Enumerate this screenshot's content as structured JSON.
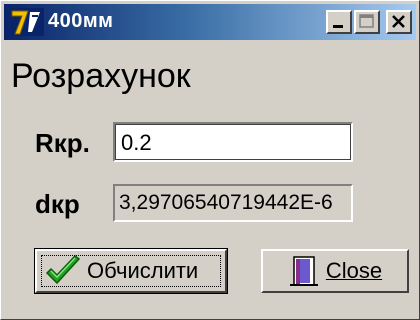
{
  "window": {
    "title": "400мм",
    "icon": "app-logo-icon",
    "controls": [
      "minimize-icon",
      "maximize-icon",
      "close-icon"
    ]
  },
  "form": {
    "heading": "Розрахунок",
    "rkp_label": "Rкр.",
    "rkp_value": "0.2",
    "dkp_label": "dкр",
    "dkp_value": "3,29706540719442E-6"
  },
  "buttons": {
    "calculate_label": "Обчислити",
    "calculate_icon": "checkmark-icon",
    "close_label": "Close",
    "close_icon": "door-exit-icon"
  },
  "colors": {
    "titlebar_start": "#0a246a",
    "titlebar_end": "#a6caf0",
    "face": "#d4d0c8",
    "check_green": "#1fa01f"
  }
}
